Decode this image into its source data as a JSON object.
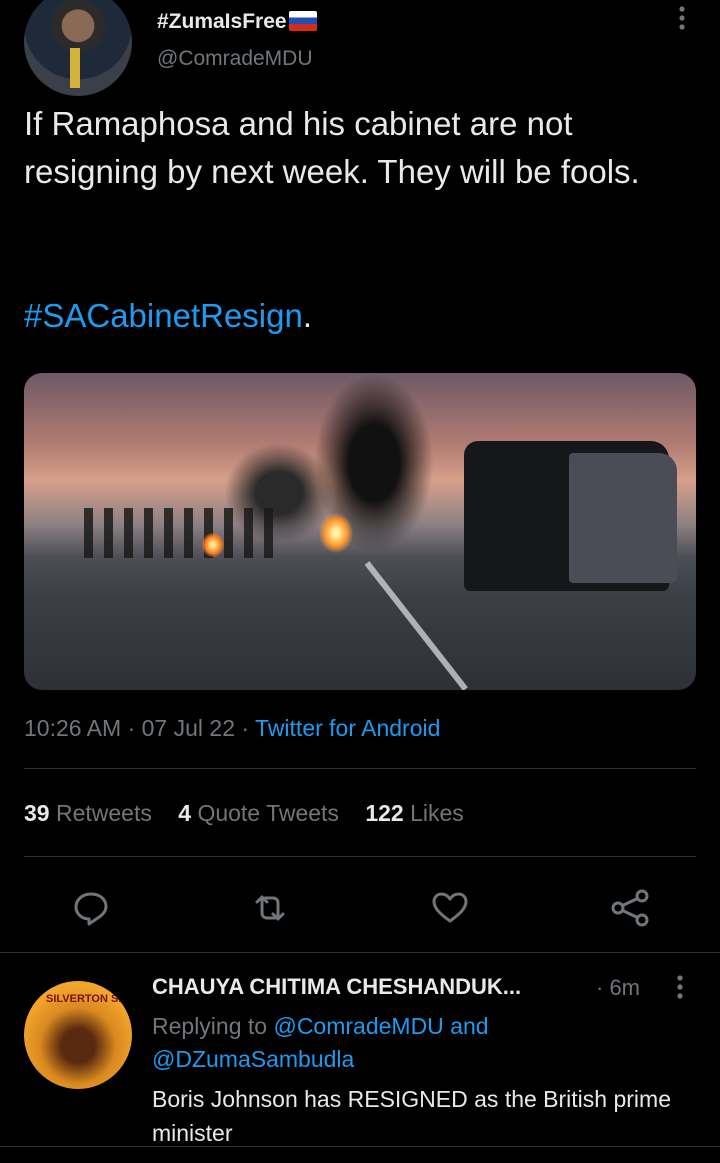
{
  "tweet": {
    "display_name": "#ZumaIsFree",
    "flag_icon": "russia-flag-icon",
    "handle": "@ComradeMDU",
    "text": "If Ramaphosa and his cabinet are not resigning by next week. They will be fools.",
    "hashtag": "#SACabinetResign",
    "hashtag_suffix": ".",
    "time": "10:26 AM",
    "date": "07 Jul 22",
    "source": "Twitter for Android",
    "dot": "·"
  },
  "stats": {
    "retweets_count": "39",
    "retweets_label": "Retweets",
    "quotes_count": "4",
    "quotes_label": "Quote Tweets",
    "likes_count": "122",
    "likes_label": "Likes"
  },
  "actions": [
    "reply-icon",
    "retweet-icon",
    "like-icon",
    "share-icon"
  ],
  "reply": {
    "display_name": "CHAUYA CHITIMA CHESHANDUK...",
    "time": "· 6m",
    "replying_prefix": "Replying to",
    "mention_1": "@ComradeMDU",
    "and": "and",
    "mention_2": "@DZumaSambudla",
    "text": "Boris Johnson has RESIGNED as the British prime minister",
    "avatar_text": "SILVERTON SIE"
  },
  "colors": {
    "background": "#000000",
    "text": "#e7e9ea",
    "muted": "#71767b",
    "accent": "#1d9bf0"
  }
}
